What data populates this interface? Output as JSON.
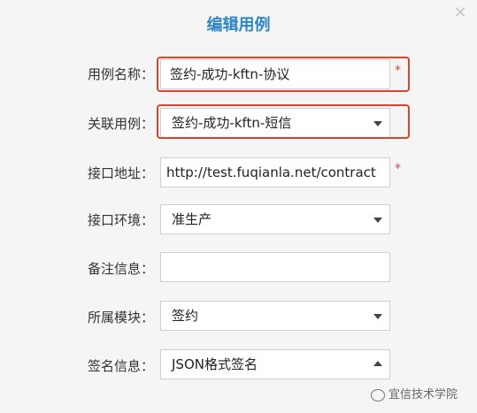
{
  "dialog": {
    "title": "编辑用例"
  },
  "fields": {
    "case_name": {
      "label": "用例名称：",
      "value": "签约-成功-kftn-协议",
      "required_mark": "*"
    },
    "related_case": {
      "label": "关联用例：",
      "value": "签约-成功-kftn-短信"
    },
    "api_address": {
      "label": "接口地址：",
      "value": "http://test.fuqianla.net/contract",
      "required_mark": "*"
    },
    "api_env": {
      "label": "接口环境：",
      "value": "准生产"
    },
    "remarks": {
      "label": "备注信息：",
      "value": ""
    },
    "module": {
      "label": "所属模块：",
      "value": "签约"
    },
    "sign_info": {
      "label": "签名信息：",
      "value": "JSON格式签名"
    }
  },
  "watermark": {
    "text": "宜信技术学院"
  },
  "colors": {
    "title": "#2d86c4",
    "highlight": "#d9462e",
    "required": "#e04040"
  },
  "icons": {
    "close": "close-icon",
    "dropdown": "chevron-down-icon",
    "dropdown_open": "chevron-up-icon"
  }
}
